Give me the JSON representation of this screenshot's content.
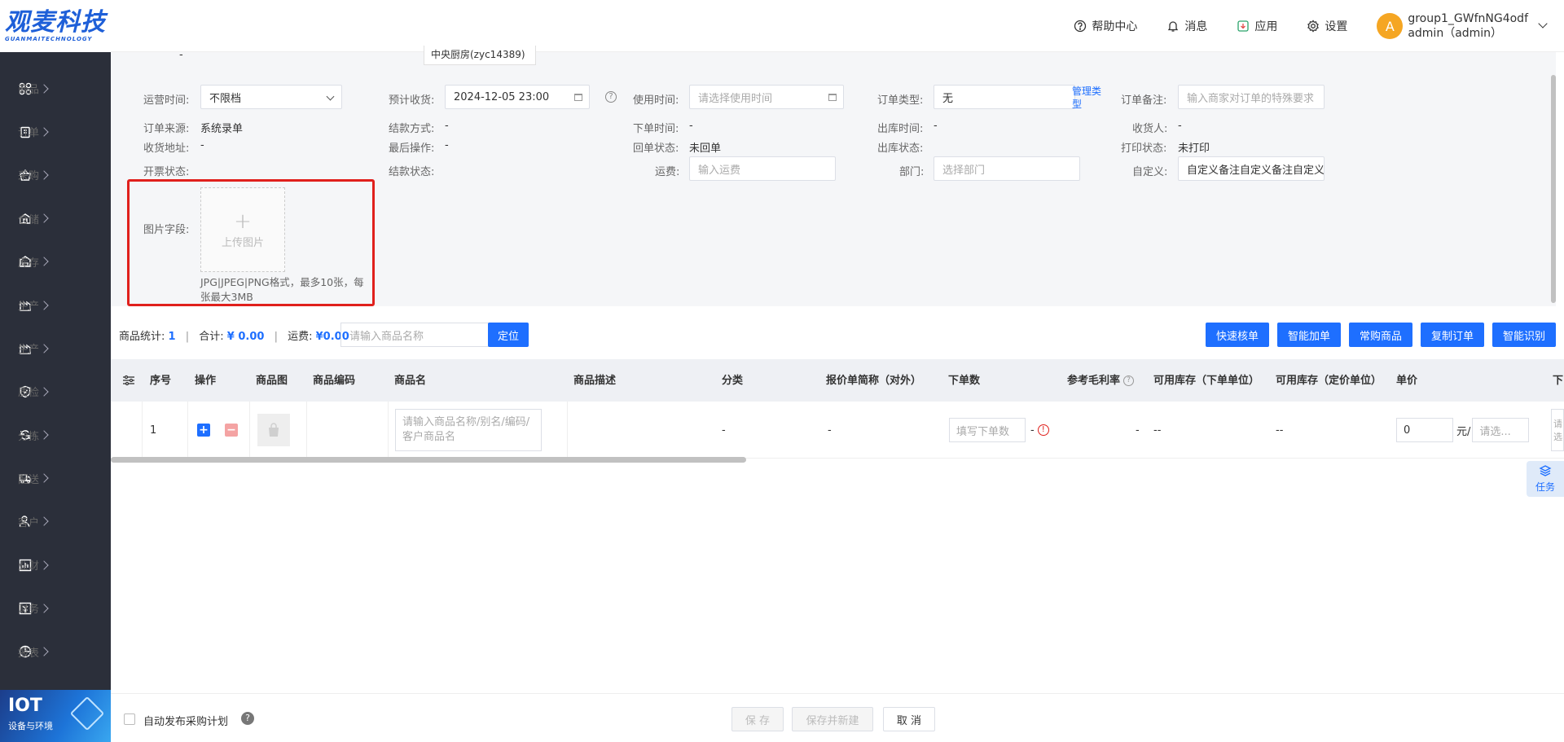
{
  "logo": {
    "main": "观麦科技",
    "sub": "GUANMAITECHNOLOGY"
  },
  "sidebar": {
    "items": [
      {
        "label": "商品",
        "icon": "grid-icon"
      },
      {
        "label": "订单",
        "icon": "clipboard-icon"
      },
      {
        "label": "采购",
        "icon": "basket-icon"
      },
      {
        "label": "仓储",
        "icon": "warehouse-icon"
      },
      {
        "label": "库存",
        "icon": "stock-icon"
      },
      {
        "label": "生产",
        "icon": "factory-icon"
      },
      {
        "label": "生产",
        "icon": "factory-icon"
      },
      {
        "label": "质检",
        "icon": "shield-icon"
      },
      {
        "label": "分拣",
        "icon": "sort-icon"
      },
      {
        "label": "配送",
        "icon": "truck-icon"
      },
      {
        "label": "客户",
        "icon": "user-icon"
      },
      {
        "label": "业财",
        "icon": "chart-icon"
      },
      {
        "label": "财务",
        "icon": "finance-icon"
      },
      {
        "label": "报表",
        "icon": "report-icon"
      }
    ],
    "iot": {
      "title": "IOT",
      "subtitle": "设备与环境"
    }
  },
  "header": {
    "help": "帮助中心",
    "messages": "消息",
    "apps": "应用",
    "settings": "设置",
    "avatar_letter": "A",
    "user_name": "group1_GWfnNG4odf",
    "user_role": "admin（admin）"
  },
  "form": {
    "partial_dash": "-",
    "partial_warehouse": "中央厨房(zyc14389)",
    "op_time_label": "运营时间:",
    "op_time_value": "不限档",
    "expected_label": "预计收货:",
    "expected_value": "2024-12-05 23:00",
    "use_time_label": "使用时间:",
    "use_time_placeholder": "请选择使用时间",
    "order_type_label": "订单类型:",
    "order_type_value": "无",
    "manage_type_link": "管理类型",
    "order_note_label": "订单备注:",
    "order_note_placeholder": "输入商家对订单的特殊要求",
    "source_label": "订单来源:",
    "source_value": "系统录单",
    "settle_method_label": "结款方式:",
    "settle_method_value": "-",
    "order_time_label": "下单时间:",
    "order_time_value": "-",
    "outbound_time_label": "出库时间:",
    "outbound_time_value": "-",
    "receiver_label": "收货人:",
    "receiver_value": "-",
    "address_label": "收货地址:",
    "address_value": "-",
    "last_op_label": "最后操作:",
    "last_op_value": "-",
    "return_label": "回单状态:",
    "return_value": "未回单",
    "outbound_status_label": "出库状态:",
    "print_label": "打印状态:",
    "print_value": "未打印",
    "invoice_label": "开票状态:",
    "settle_status_label": "结款状态:",
    "freight_label": "运费:",
    "freight_placeholder": "输入运费",
    "dept_label": "部门:",
    "dept_placeholder": "选择部门",
    "custom_label": "自定义:",
    "custom_value": "自定义备注自定义备注自定义",
    "image_label": "图片字段:",
    "upload_text": "上传图片",
    "upload_hint": "JPG|JPEG|PNG格式，最多10张，每张最大3MB"
  },
  "products": {
    "count_label": "商品统计:",
    "count_value": "1",
    "total_label": "合计:",
    "total_value": "¥ 0.00",
    "freight_label": "运费:",
    "freight_value": "¥0.00",
    "search_placeholder": "请输入商品名称",
    "locate_button": "定位",
    "actions": [
      "快速核单",
      "智能加单",
      "常购商品",
      "复制订单",
      "智能识别"
    ]
  },
  "table": {
    "headers": {
      "seq": "序号",
      "op": "操作",
      "img": "商品图",
      "code": "商品编码",
      "name": "商品名",
      "desc": "商品描述",
      "category": "分类",
      "quote": "报价单简称（对外）",
      "qty": "下单数",
      "margin": "参考毛利率",
      "stock_order": "可用库存（下单单位）",
      "stock_price": "可用库存（定价单位）",
      "price": "单价",
      "next": "下"
    },
    "row": {
      "seq": "1",
      "name_placeholder": "请输入商品名称/别名/编码/客户商品名",
      "category": "-",
      "quote": "-",
      "qty_placeholder": "填写下单数",
      "qty_dash": "-",
      "margin": "-",
      "stock_order": "--",
      "stock_price": "--",
      "price_value": "0",
      "price_unit": "元/",
      "unit_placeholder": "请选...",
      "next_partial": "请选"
    }
  },
  "task_label": "任务",
  "footer": {
    "auto_publish": "自动发布采购计划",
    "help_mark": "?",
    "save": "保 存",
    "save_new": "保存并新建",
    "cancel": "取 消"
  },
  "colors": {
    "primary": "#1e6fff",
    "sidebar": "#2b2f3a",
    "highlight": "#e0201c"
  }
}
